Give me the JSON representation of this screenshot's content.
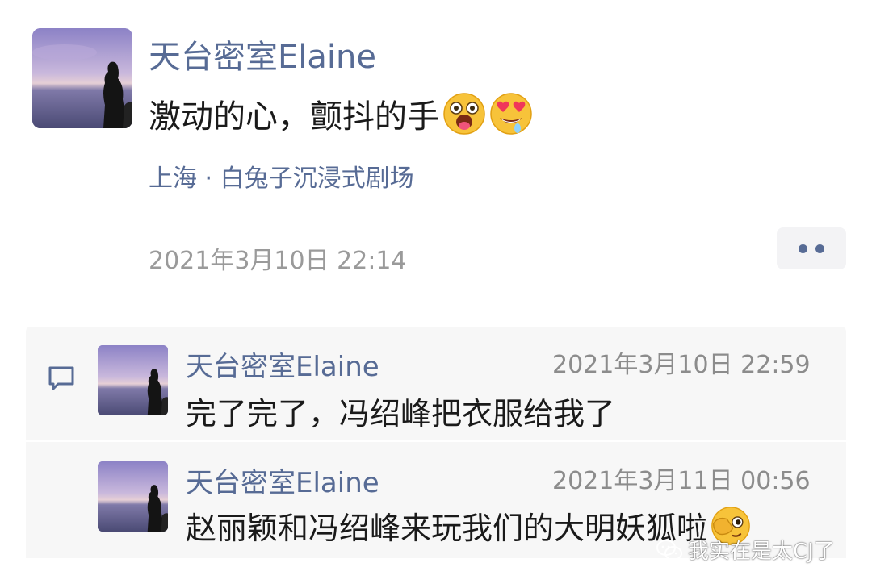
{
  "post": {
    "author": "天台密室Elaine",
    "text": "激动的心，颤抖的手",
    "emojis": [
      "zany-face-emoji",
      "heart-eyes-drooling-emoji"
    ],
    "location": "上海 · 白兔子沉浸式剧场",
    "timestamp": "2021年3月10日 22:14"
  },
  "comments": [
    {
      "author": "天台密室Elaine",
      "timestamp": "2021年3月10日 22:59",
      "text": "完了完了，冯绍峰把衣服给我了"
    },
    {
      "author": "天台密室Elaine",
      "timestamp": "2021年3月11日 00:56",
      "text": "赵丽颖和冯绍峰来玩我们的大明妖狐啦",
      "emoji": "face-peeking-emoji"
    }
  ],
  "watermark": {
    "text": "我实在是太CJ了",
    "icon": "wechat-icon"
  },
  "colors": {
    "link_blue": "#576b95",
    "text": "#1a1a1a",
    "muted": "#9a9a9a",
    "comment_bg": "#f7f7f7"
  }
}
